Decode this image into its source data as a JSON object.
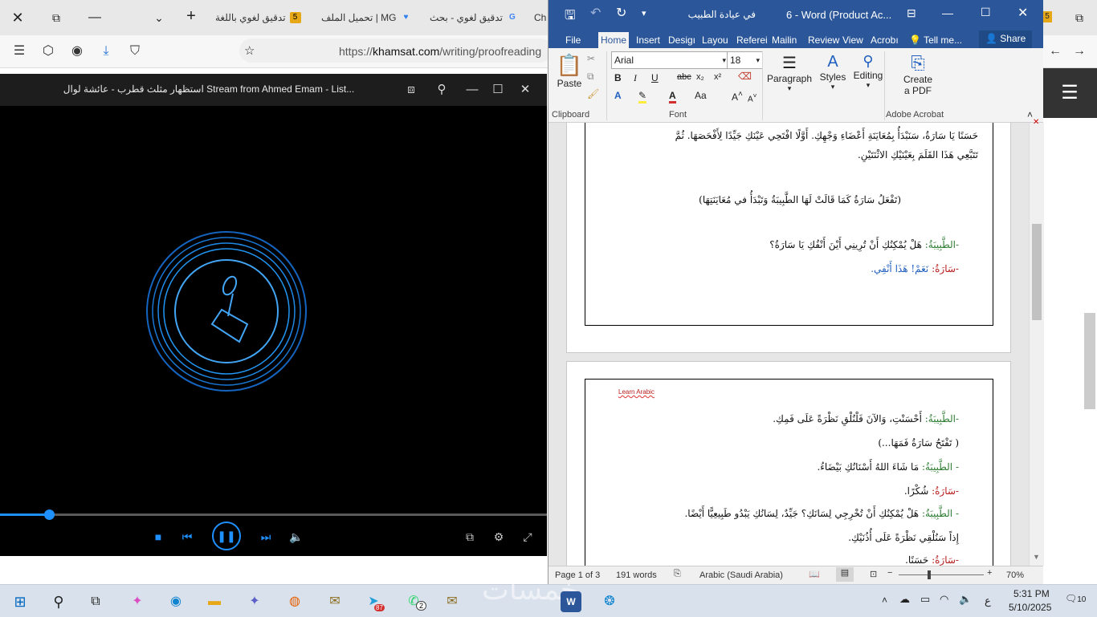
{
  "browser": {
    "tabs": [
      {
        "label": "تدقيق لغوي باللغة",
        "badge": "5"
      },
      {
        "label": "تحميل الملف | MG",
        "badge": ""
      },
      {
        "label": "تدقيق لغوي - بحث",
        "badge": ""
      },
      {
        "label": "Ch",
        "badge": ""
      }
    ],
    "address": {
      "prefix": "https://",
      "domain": "khamsat.com",
      "path": "/writing/proofreading"
    },
    "right_badge": "5"
  },
  "player": {
    "title": "استظهار مثلث قطرب - عائشة لوال Stream from Ahmed Emam - List...",
    "progress": 0.09,
    "colors": {
      "accent": "#1e90ff"
    }
  },
  "word": {
    "title": "في عيادة الطبيب",
    "title_app": "6 - Word (Product Ac...",
    "tabs": [
      "File",
      "Home",
      "Insert",
      "Design",
      "Layout",
      "References",
      "Mailings",
      "Review",
      "View",
      "Acrobat"
    ],
    "tabs_display": [
      "File",
      "Home",
      "Insert",
      "Desigı",
      "Layou",
      "Referei",
      "Mailin",
      "Review",
      "View",
      "Acrobı"
    ],
    "tell_me": "Tell me...",
    "share": "Share",
    "font_name": "Arial",
    "font_size": "18",
    "groups": {
      "clipboard": "Clipboard",
      "font": "Font",
      "adobe": "Adobe Acrobat"
    },
    "buttons": {
      "paste": "Paste",
      "paragraph": "Paragraph",
      "styles": "Styles",
      "editing": "Editing",
      "create_pdf_1": "Create",
      "create_pdf_2": "a PDF"
    },
    "page1": {
      "line1": "حَسَنًا يَا سَارَةُ، سَنَبْدَأُ بِمُعَايَنَةِ أَعْضَاءِ وَجْهِكِ. أَوَّلًا افْتَحِي عَيْنَكِ جَيِّدًا لِأَفْحَصَهَا. ثُمَّ",
      "line2": "تَتَبَّعِي هَذَا القَلَمَ بِعَيْنَيْكِ الاثْنَتَيْنِ.",
      "line3": "(تَفْعَلُ سَارَةُ كَمَا قَالَتْ لَهَا الطَّبِيبَةُ وَتَبْدَأُ في مُعَايَنَتِهَا)",
      "line4_speaker": "-الطَّبِيبَةُ: ",
      "line4_text": "هَلْ يُمْكِنُكِ أَنْ تُرِينِي أَيْنَ أَنْفُكِ يَا سَارَةُ؟",
      "line5_speaker": "-سَارَةُ: ",
      "line5_text": "نَعَمْ! هَذَا أَنْفِي."
    },
    "page2": {
      "header": "Learn Arabic",
      "l1_speaker": "-الطَّبِيبَةُ: ",
      "l1_text": "أَحْسَنْتِ، وَالآنَ فَلْنُلْقِ نَظْرَةً عَلَى فَمِكِ.",
      "l2": "( تَفْتَحُ سَارَةُ فَمَهَا...)",
      "l3_speaker": "- الطَّبِيبَةُ: ",
      "l3_text": "مَا شَاءَ اللهُ أَسْنَانُكِ بَيْضَاءُ.",
      "l4_speaker": "-سَارَةُ: ",
      "l4_text": "شُكْرًا.",
      "l5_speaker": "- الطَّبِيبَةُ: ",
      "l5_text": "هَلْ يُمْكِنُكِ أَنْ تُخْرِجِي لِسَانَكِ؟ جَيِّدٌ، لِسَانُكِ يَبْدُو طَبِيعِيًّا أَيْضًا.",
      "l6": "إِذاً سَنُلْقِي نَظْرَةً عَلَى أُذُنَيْكِ.",
      "l7_speaker": "-سَارَةُ: ",
      "l7_text": "حَسَنًا."
    },
    "status": {
      "page": "Page 1 of 3",
      "words": "191 words",
      "language": "Arabic (Saudi Arabia)",
      "zoom": "70%"
    }
  },
  "taskbar": {
    "time": "5:31 PM",
    "date": "5/10/2025",
    "lang": "ع",
    "notifications": "10",
    "telegram_badge": "87",
    "whatsapp_badge": "2",
    "watermark": "خمسات"
  }
}
